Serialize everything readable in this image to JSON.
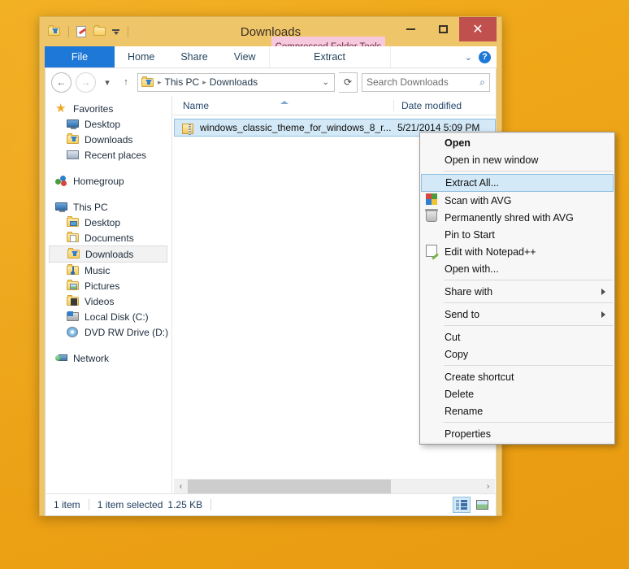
{
  "desktop": {
    "background_color": "#f0a81a"
  },
  "window": {
    "title": "Downloads",
    "frame_color": "#efc56a",
    "contextual_tab": {
      "label": "Compressed Folder Tools",
      "background_color": "#f7c9dd"
    },
    "quick_access": [
      {
        "name": "downloads-folder-icon",
        "label": "Downloads"
      },
      {
        "name": "properties-icon",
        "label": "Properties"
      },
      {
        "name": "new-folder-icon",
        "label": "New folder"
      },
      {
        "name": "customize-qat-icon",
        "label": "Customize Quick Access Toolbar"
      }
    ],
    "caption_buttons": {
      "minimize": "–",
      "maximize": "❐",
      "close": "✕",
      "close_color": "#c0504d"
    }
  },
  "ribbon": {
    "tabs": [
      {
        "label": "File",
        "active": true,
        "accent": "#1e78d7"
      },
      {
        "label": "Home",
        "active": false
      },
      {
        "label": "Share",
        "active": false
      },
      {
        "label": "View",
        "active": false
      },
      {
        "label": "Extract",
        "active": false
      }
    ],
    "collapse_label": "⌄",
    "help_label": "?"
  },
  "addressbar": {
    "back": "←",
    "forward": "→",
    "recent_dropdown": "▾",
    "up": "↑",
    "breadcrumb": [
      "This PC",
      "Downloads"
    ],
    "breadcrumb_separator": "▸",
    "breadcrumb_dropdown": "⌄",
    "refresh": "⟳",
    "search_placeholder": "Search Downloads",
    "search_value": "",
    "search_icon": "⌕"
  },
  "navpane": {
    "groups": [
      {
        "header": {
          "label": "Favorites",
          "icon": "star-icon"
        },
        "items": [
          {
            "label": "Desktop",
            "icon": "monitor-icon"
          },
          {
            "label": "Downloads",
            "icon": "downloads-folder-icon"
          },
          {
            "label": "Recent places",
            "icon": "recent-places-icon"
          }
        ]
      },
      {
        "header": {
          "label": "Homegroup",
          "icon": "homegroup-icon"
        },
        "items": []
      },
      {
        "header": {
          "label": "This PC",
          "icon": "this-pc-icon"
        },
        "items": [
          {
            "label": "Desktop",
            "icon": "desktop-folder-icon",
            "selected": false
          },
          {
            "label": "Documents",
            "icon": "documents-folder-icon",
            "selected": false
          },
          {
            "label": "Downloads",
            "icon": "downloads-folder-icon",
            "selected": true
          },
          {
            "label": "Music",
            "icon": "music-folder-icon",
            "selected": false
          },
          {
            "label": "Pictures",
            "icon": "pictures-folder-icon",
            "selected": false
          },
          {
            "label": "Videos",
            "icon": "videos-folder-icon",
            "selected": false
          },
          {
            "label": "Local Disk (C:)",
            "icon": "local-disk-icon",
            "selected": false
          },
          {
            "label": "DVD RW Drive (D:) G",
            "icon": "dvd-drive-icon",
            "selected": false
          }
        ]
      },
      {
        "header": {
          "label": "Network",
          "icon": "network-icon"
        },
        "items": []
      }
    ]
  },
  "filelist": {
    "columns": [
      "Name",
      "Date modified"
    ],
    "sort_column": "Name",
    "sort_direction": "asc",
    "rows": [
      {
        "name": "windows_classic_theme_for_windows_8_r...",
        "date_modified": "5/21/2014 5:09 PM",
        "icon": "zip-archive-icon",
        "selected": true
      }
    ],
    "hscroll": {
      "left_arrow": "‹",
      "right_arrow": "›"
    }
  },
  "statusbar": {
    "item_count": "1 item",
    "selection": "1 item selected",
    "size": "1.25 KB",
    "views": [
      {
        "name": "details-view-button",
        "label": "Details view",
        "active": true
      },
      {
        "name": "large-icons-view-button",
        "label": "Large icons view",
        "active": false
      }
    ]
  },
  "context_menu": {
    "sections": [
      {
        "items": [
          {
            "label": "Open",
            "bold": true,
            "icon": null,
            "submenu": false,
            "highlighted": false
          },
          {
            "label": "Open in new window",
            "bold": false,
            "icon": null,
            "submenu": false,
            "highlighted": false
          }
        ]
      },
      {
        "items": [
          {
            "label": "Extract All...",
            "bold": false,
            "icon": null,
            "submenu": false,
            "highlighted": true
          },
          {
            "label": "Scan with AVG",
            "bold": false,
            "icon": "avg-icon",
            "submenu": false,
            "highlighted": false
          },
          {
            "label": "Permanently shred with AVG",
            "bold": false,
            "icon": "shred-icon",
            "submenu": false,
            "highlighted": false
          },
          {
            "label": "Pin to Start",
            "bold": false,
            "icon": null,
            "submenu": false,
            "highlighted": false
          },
          {
            "label": "Edit with Notepad++",
            "bold": false,
            "icon": "notepadpp-icon",
            "submenu": false,
            "highlighted": false
          },
          {
            "label": "Open with...",
            "bold": false,
            "icon": null,
            "submenu": false,
            "highlighted": false
          }
        ]
      },
      {
        "items": [
          {
            "label": "Share with",
            "bold": false,
            "icon": null,
            "submenu": true,
            "highlighted": false
          }
        ]
      },
      {
        "items": [
          {
            "label": "Send to",
            "bold": false,
            "icon": null,
            "submenu": true,
            "highlighted": false
          }
        ]
      },
      {
        "items": [
          {
            "label": "Cut",
            "bold": false,
            "icon": null,
            "submenu": false,
            "highlighted": false
          },
          {
            "label": "Copy",
            "bold": false,
            "icon": null,
            "submenu": false,
            "highlighted": false
          }
        ]
      },
      {
        "items": [
          {
            "label": "Create shortcut",
            "bold": false,
            "icon": null,
            "submenu": false,
            "highlighted": false
          },
          {
            "label": "Delete",
            "bold": false,
            "icon": null,
            "submenu": false,
            "highlighted": false
          },
          {
            "label": "Rename",
            "bold": false,
            "icon": null,
            "submenu": false,
            "highlighted": false
          }
        ]
      },
      {
        "items": [
          {
            "label": "Properties",
            "bold": false,
            "icon": null,
            "submenu": false,
            "highlighted": false
          }
        ]
      }
    ]
  }
}
